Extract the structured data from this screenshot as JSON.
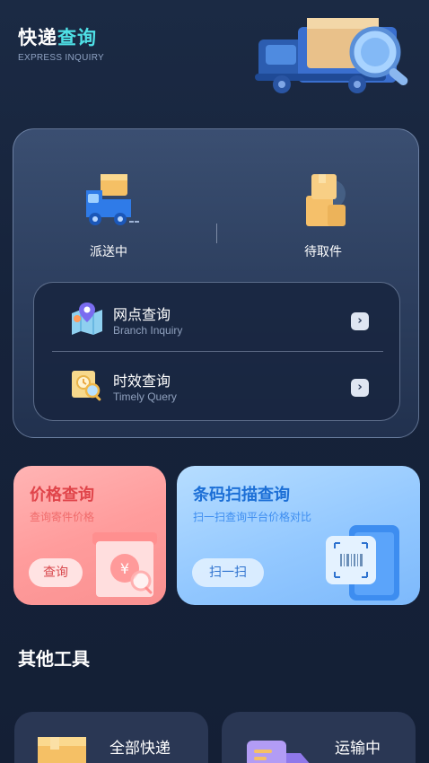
{
  "header": {
    "title_part1": "快递",
    "title_part2": "查询",
    "subtitle": "EXPRESS INQUIRY"
  },
  "status": [
    {
      "label": "派送中",
      "icon": "delivery-truck-icon"
    },
    {
      "label": "待取件",
      "icon": "package-stack-icon"
    }
  ],
  "inquiries": [
    {
      "title": "网点查询",
      "subtitle": "Branch Inquiry",
      "icon": "map-location-icon"
    },
    {
      "title": "时效查询",
      "subtitle": "Timely Query",
      "icon": "clock-search-icon"
    }
  ],
  "features": {
    "price": {
      "title": "价格查询",
      "subtitle": "查询寄件价格",
      "button": "查询"
    },
    "barcode": {
      "title": "条码扫描查询",
      "subtitle": "扫一扫查询平台价格对比",
      "button": "扫一扫"
    }
  },
  "other_tools": {
    "title": "其他工具",
    "items": [
      {
        "label": "全部快递",
        "icon": "all-packages-icon"
      },
      {
        "label": "运输中",
        "icon": "in-transit-icon"
      }
    ]
  },
  "colors": {
    "accent_cyan": "#4fe0e6",
    "price_card": "#ff9c9c",
    "barcode_card": "#93c8ff"
  }
}
